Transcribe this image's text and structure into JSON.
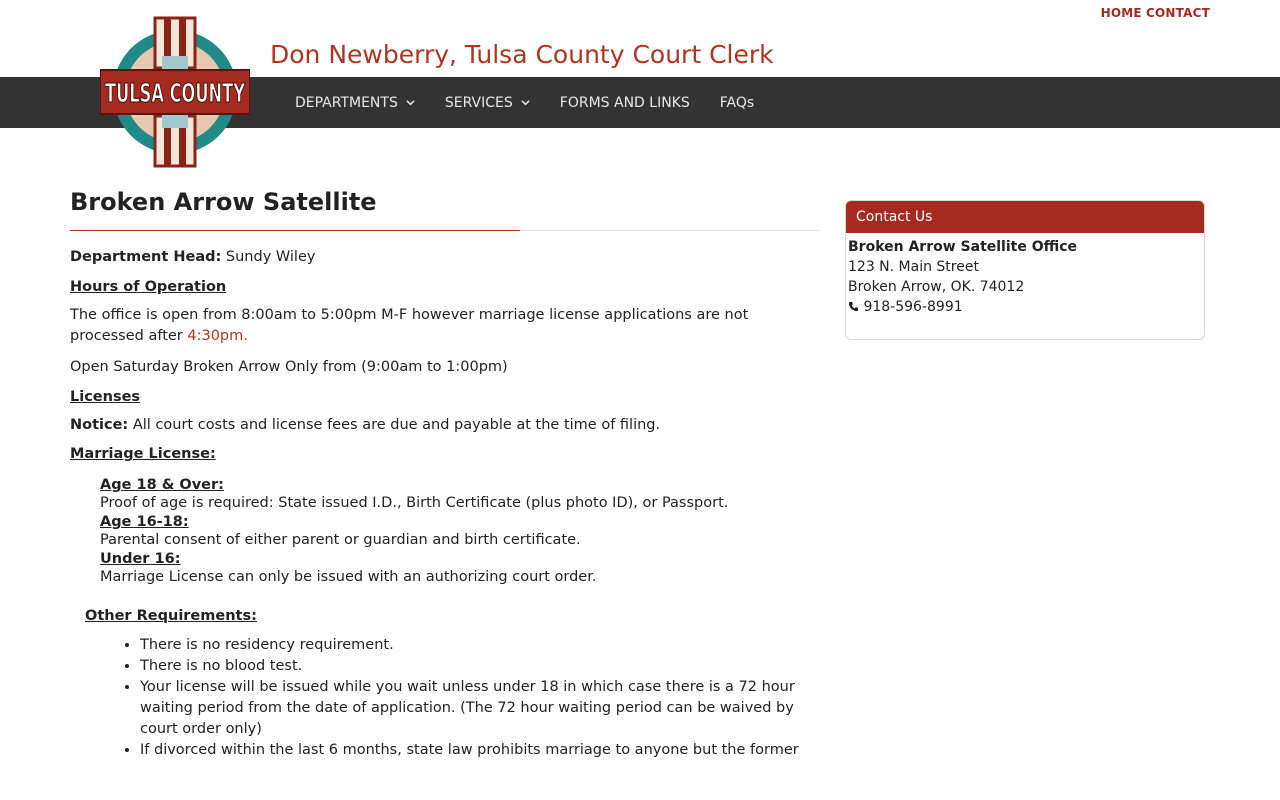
{
  "header": {
    "top_links": [
      "HOME",
      "CONTACT"
    ],
    "site_title": "Don Newberry, Tulsa County Court Clerk",
    "logo_text": "TULSA COUNTY"
  },
  "nav": {
    "departments": "DEPARTMENTS",
    "services": "SERVICES",
    "forms": "FORMS AND LINKS",
    "faqs": "FAQs"
  },
  "page": {
    "title": "Broken Arrow Satellite",
    "dept_head_label": "Department Head:",
    "dept_head_name": " Sundy Wiley",
    "hours_heading": "Hours of Operation",
    "hours_text": "The office is open from 8:00am to 5:00pm M-F however marriage license applications are not processed after ",
    "hours_time": "4:30pm.",
    "saturday": "Open Saturday Broken Arrow Only from (9:00am to 1:00pm)",
    "licenses_heading": "Licenses",
    "notice_label": "Notice:",
    "notice_text": " All court costs and license fees are due and payable at the time of filing.",
    "marriage_heading": "Marriage License:",
    "age18_heading": "Age 18 & Over:",
    "age18_text": "Proof of age is required: State issued I.D., Birth Certificate (plus photo ID), or Passport.",
    "age1618_heading": "Age 16-18:",
    "age1618_text": "Parental consent of either parent or guardian and birth certificate.",
    "under16_heading": "Under 16:",
    "under16_text": "Marriage License can only be issued with an authorizing court order.",
    "other_heading": "Other Requirements:",
    "requirements": [
      "There is no residency requirement.",
      "There is no blood test.",
      "Your license will be issued while you wait unless under 18 in which case there is a 72 hour waiting period from the date of application. (The 72 hour waiting period can be waived by court order only)",
      "If divorced within the last 6 months, state law prohibits marriage to anyone but the former"
    ]
  },
  "sidebar": {
    "heading": "Contact Us",
    "office": "Broken Arrow Satellite Office",
    "address1": "123 N. Main Street",
    "address2": "Broken Arrow, OK. 74012",
    "phone": "918-596-8991"
  },
  "colors": {
    "brand_red": "#a52a1f",
    "nav_bg": "#333333"
  }
}
